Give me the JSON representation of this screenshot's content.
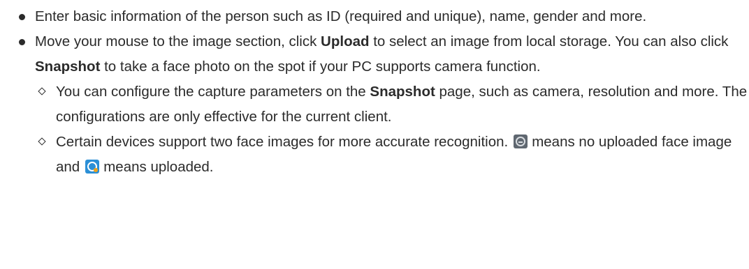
{
  "items": [
    {
      "text": "Enter basic information of the person such as ID (required and unique), name, gender and more."
    },
    {
      "t1": "Move your mouse to the image section, click ",
      "b1": "Upload",
      "t2": " to select an image from local storage. You can also click ",
      "b2": "Snapshot",
      "t3": " to take a face photo on the spot if your PC supports camera function.",
      "sub": [
        {
          "t1": "You can configure the capture parameters on the ",
          "b1": "Snapshot",
          "t2": " page, such as camera, resolution and more. The configurations are only effective for the current client."
        },
        {
          "t1": "Certain devices support two face images for more accurate recognition.",
          "icon1": "face-not-uploaded-icon",
          "t2": "means no uploaded face image and",
          "icon2": "face-uploaded-icon",
          "t3": "means uploaded."
        }
      ]
    }
  ]
}
